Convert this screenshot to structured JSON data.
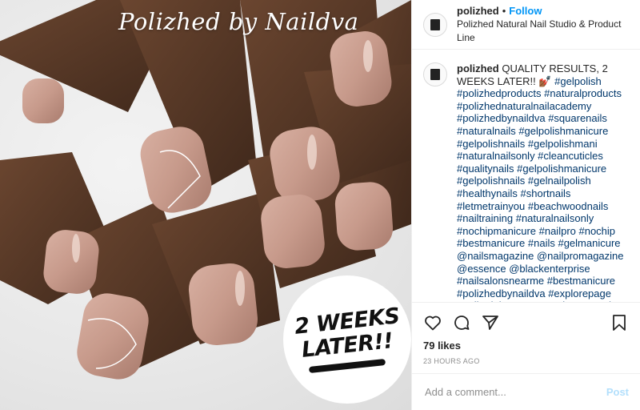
{
  "photo": {
    "watermark": "Polizhed by Naildva",
    "badge_line1": "2 WEEKS",
    "badge_line2": "LATER!!"
  },
  "header": {
    "username": "polizhed",
    "separator": "•",
    "follow_label": "Follow",
    "subtitle": "Polizhed Natural Nail Studio & Product Line"
  },
  "caption": {
    "username": "polizhed",
    "text": "QUALITY RESULTS, 2 WEEKS LATER!!",
    "emoji": "💅🏾",
    "hashtags": "#gelpolish #polizhedproducts #naturalproducts #polizhednaturalnailacademy #polizhedbynaildva #squarenails #naturalnails #gelpolishmanicure #gelpolishnails #gelpolishmani #naturalnailsonly #cleancuticles #qualitynails #gelpolishmanicure #gelpolishnails #gelnailpolish #healthynails #shortnails #letmetrainyou #beachwoodnails #nailtraining #naturalnailsonly #nochipmanicure #nailpro #nochip #bestmanicure #nails #gelmanicure @nailsmagazine @nailpromagazine @essence @blackenterprise #nailsalonsnearme #bestmanicure #polizhedbynaildva #explorepage #nailtrainingguru #manicuremonday"
  },
  "actions": {
    "icons": [
      "heart-icon",
      "comment-icon",
      "share-icon",
      "bookmark-icon"
    ],
    "likes": "79 likes",
    "timestamp": "23 HOURS AGO"
  },
  "comment": {
    "placeholder": "Add a comment...",
    "post_label": "Post"
  },
  "colors": {
    "link": "#00376b",
    "follow": "#0095f6",
    "post_disabled": "#b2dffc",
    "nail_polish": "#c9a093",
    "skin": "#5a3a28"
  }
}
